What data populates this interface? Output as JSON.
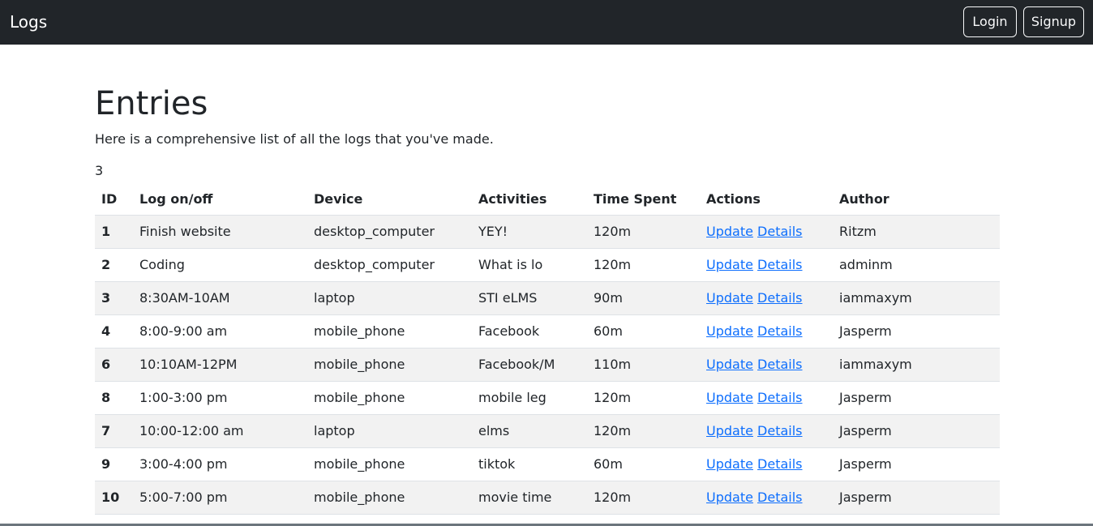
{
  "navbar": {
    "brand": "Logs",
    "login_label": "Login",
    "signup_label": "Signup"
  },
  "main": {
    "title": "Entries",
    "subtitle": "Here is a comprehensive list of all the logs that you've made.",
    "count": "3"
  },
  "table": {
    "headers": [
      "ID",
      "Log on/off",
      "Device",
      "Activities",
      "Time Spent",
      "Actions",
      "Author"
    ],
    "update_label": "Update",
    "details_label": "Details",
    "rows": [
      {
        "id": "1",
        "log": "Finish website",
        "device": "desktop_computer",
        "activities": "YEY!",
        "time": "120m",
        "author": "Ritzm"
      },
      {
        "id": "2",
        "log": "Coding",
        "device": "desktop_computer",
        "activities": "What is lo",
        "time": "120m",
        "author": "adminm"
      },
      {
        "id": "3",
        "log": "8:30AM-10AM",
        "device": "laptop",
        "activities": "STI eLMS",
        "time": "90m",
        "author": "iammaxym"
      },
      {
        "id": "4",
        "log": "8:00-9:00 am",
        "device": "mobile_phone",
        "activities": "Facebook",
        "time": "60m",
        "author": "Jasperm"
      },
      {
        "id": "6",
        "log": "10:10AM-12PM",
        "device": "mobile_phone",
        "activities": "Facebook/M",
        "time": "110m",
        "author": "iammaxym"
      },
      {
        "id": "8",
        "log": "1:00-3:00 pm",
        "device": "mobile_phone",
        "activities": "mobile leg",
        "time": "120m",
        "author": "Jasperm"
      },
      {
        "id": "7",
        "log": "10:00-12:00 am",
        "device": "laptop",
        "activities": "elms",
        "time": "120m",
        "author": "Jasperm"
      },
      {
        "id": "9",
        "log": "3:00-4:00 pm",
        "device": "mobile_phone",
        "activities": "tiktok",
        "time": "60m",
        "author": "Jasperm"
      },
      {
        "id": "10",
        "log": "5:00-7:00 pm",
        "device": "mobile_phone",
        "activities": "movie time",
        "time": "120m",
        "author": "Jasperm"
      }
    ]
  }
}
